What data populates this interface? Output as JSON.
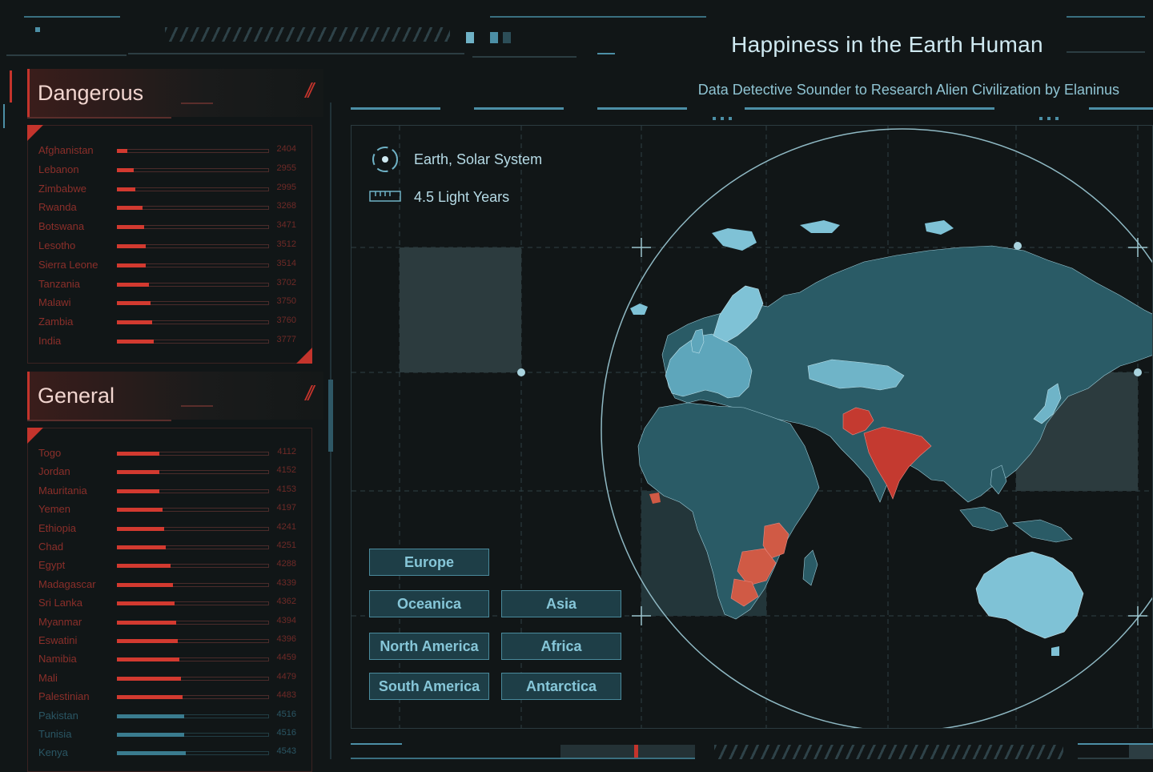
{
  "header": {
    "title": "Happiness in the Earth Human",
    "subtitle": "Data Detective Sounder to Research Alien Civilization by Elaninus"
  },
  "dangerous": {
    "title": "Dangerous",
    "rows": [
      {
        "name": "Afghanistan",
        "value": "2404",
        "fraction": 0.07
      },
      {
        "name": "Lebanon",
        "value": "2955",
        "fraction": 0.11
      },
      {
        "name": "Zimbabwe",
        "value": "2995",
        "fraction": 0.12
      },
      {
        "name": "Rwanda",
        "value": "3268",
        "fraction": 0.17
      },
      {
        "name": "Botswana",
        "value": "3471",
        "fraction": 0.18
      },
      {
        "name": "Lesotho",
        "value": "3512",
        "fraction": 0.19
      },
      {
        "name": "Sierra Leone",
        "value": "3514",
        "fraction": 0.19
      },
      {
        "name": "Tanzania",
        "value": "3702",
        "fraction": 0.21
      },
      {
        "name": "Malawi",
        "value": "3750",
        "fraction": 0.22
      },
      {
        "name": "Zambia",
        "value": "3760",
        "fraction": 0.23
      },
      {
        "name": "India",
        "value": "3777",
        "fraction": 0.24
      }
    ]
  },
  "general": {
    "title": "General",
    "rows": [
      {
        "name": "Togo",
        "value": "4112",
        "fraction": 0.28,
        "color": "red"
      },
      {
        "name": "Jordan",
        "value": "4152",
        "fraction": 0.28,
        "color": "red"
      },
      {
        "name": "Mauritania",
        "value": "4153",
        "fraction": 0.28,
        "color": "red"
      },
      {
        "name": "Yemen",
        "value": "4197",
        "fraction": 0.3,
        "color": "red"
      },
      {
        "name": "Ethiopia",
        "value": "4241",
        "fraction": 0.31,
        "color": "red"
      },
      {
        "name": "Chad",
        "value": "4251",
        "fraction": 0.32,
        "color": "red"
      },
      {
        "name": "Egypt",
        "value": "4288",
        "fraction": 0.35,
        "color": "red"
      },
      {
        "name": "Madagascar",
        "value": "4339",
        "fraction": 0.37,
        "color": "red"
      },
      {
        "name": "Sri Lanka",
        "value": "4362",
        "fraction": 0.38,
        "color": "red"
      },
      {
        "name": "Myanmar",
        "value": "4394",
        "fraction": 0.39,
        "color": "red"
      },
      {
        "name": "Eswatini",
        "value": "4396",
        "fraction": 0.4,
        "color": "red"
      },
      {
        "name": "Namibia",
        "value": "4459",
        "fraction": 0.41,
        "color": "red"
      },
      {
        "name": "Mali",
        "value": "4479",
        "fraction": 0.42,
        "color": "red"
      },
      {
        "name": "Palestinian",
        "value": "4483",
        "fraction": 0.43,
        "color": "red"
      },
      {
        "name": "Pakistan",
        "value": "4516",
        "fraction": 0.44,
        "color": "blue"
      },
      {
        "name": "Tunisia",
        "value": "4516",
        "fraction": 0.44,
        "color": "blue"
      },
      {
        "name": "Kenya",
        "value": "4543",
        "fraction": 0.45,
        "color": "blue"
      }
    ]
  },
  "map": {
    "location": "Earth, Solar System",
    "distance": "4.5 Light Years",
    "buttons": {
      "europe": "Europe",
      "oceanica": "Oceanica",
      "asia": "Asia",
      "north_america": "North America",
      "africa": "Africa",
      "south_america": "South America",
      "antarctica": "Antarctica"
    }
  },
  "colors": {
    "danger": "#d23a30",
    "accent": "#4c8fa6",
    "land": "#2a5b66",
    "land_light": "#7fc2d6",
    "background": "#111617"
  }
}
